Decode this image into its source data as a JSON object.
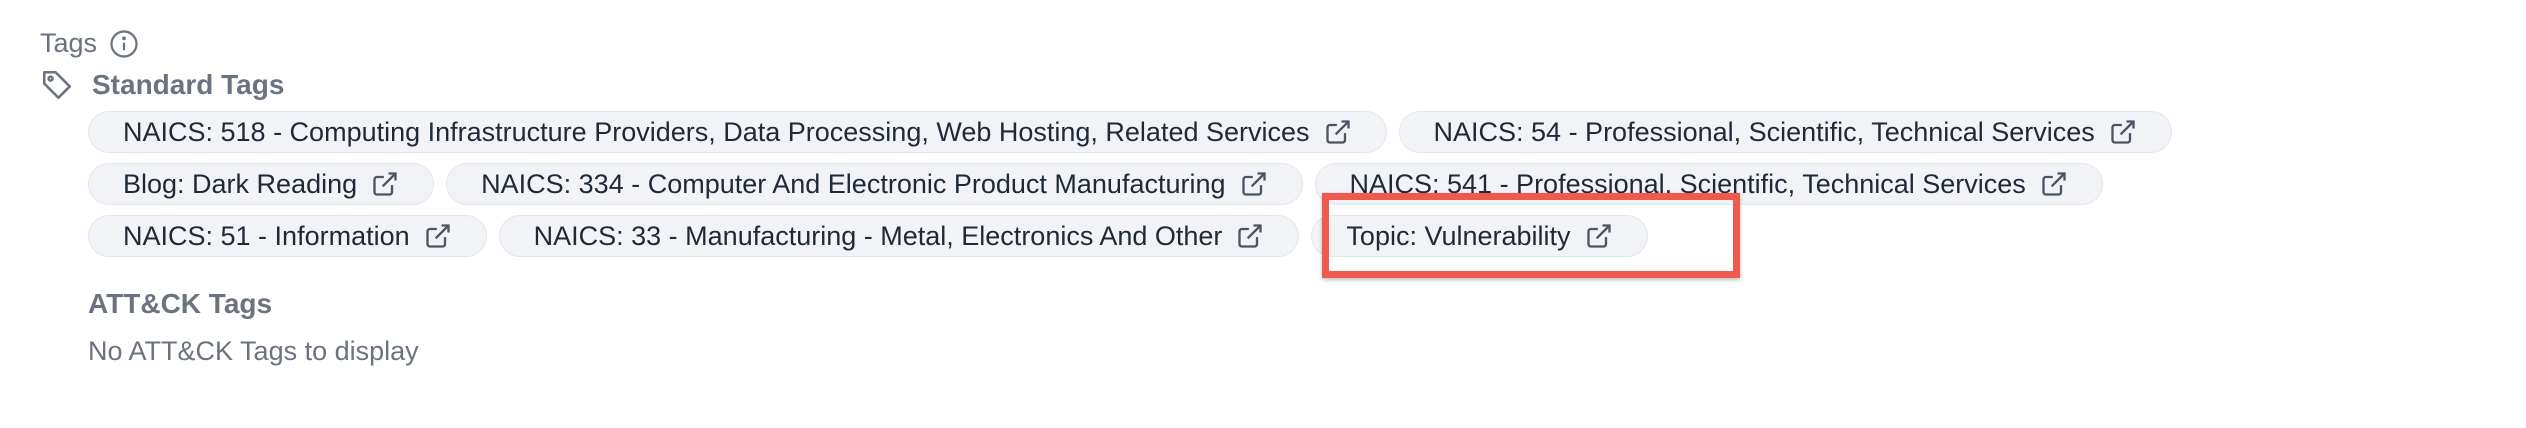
{
  "tags_label": "Tags",
  "standard_tags": {
    "title": "Standard Tags",
    "rows": [
      [
        {
          "label": "NAICS: 518 - Computing Infrastructure Providers, Data Processing, Web Hosting, Related Services"
        },
        {
          "label": "NAICS: 54 - Professional, Scientific, Technical Services"
        }
      ],
      [
        {
          "label": "Blog: Dark Reading"
        },
        {
          "label": "NAICS: 334 - Computer And Electronic Product Manufacturing"
        },
        {
          "label": "NAICS: 541 - Professional, Scientific, Technical Services"
        }
      ],
      [
        {
          "label": "NAICS: 51 - Information"
        },
        {
          "label": "NAICS: 33 - Manufacturing - Metal, Electronics And Other"
        },
        {
          "label": "Topic: Vulnerability"
        }
      ]
    ]
  },
  "attack_tags": {
    "title": "ATT&CK Tags",
    "empty_message": "No ATT&CK Tags to display"
  },
  "highlight_color": "#ef5a4e"
}
